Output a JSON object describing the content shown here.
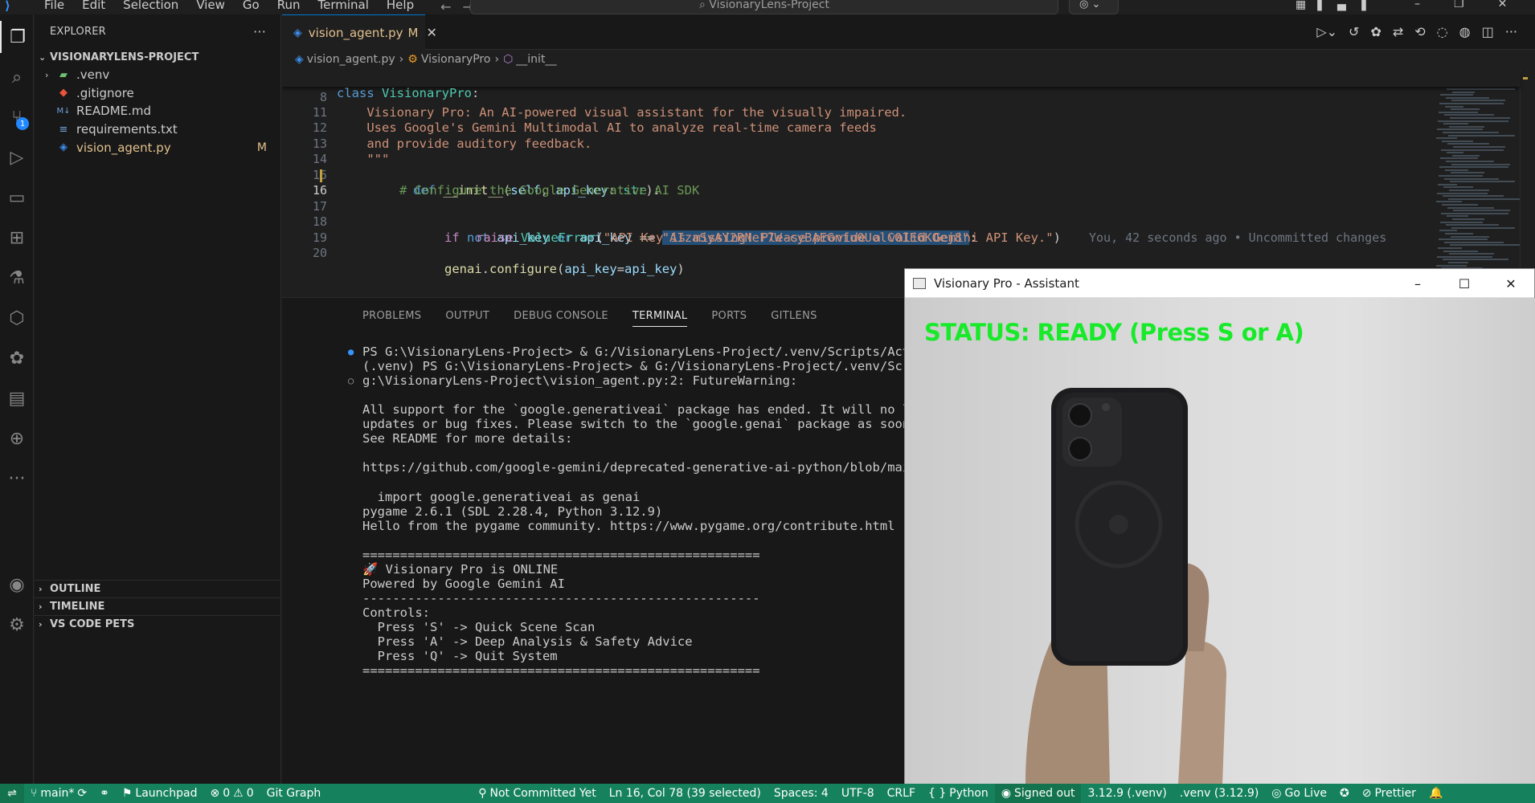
{
  "titlebar": {
    "menu": [
      "File",
      "Edit",
      "Selection",
      "View",
      "Go",
      "Run",
      "Terminal",
      "Help"
    ],
    "search_text": "VisionaryLens-Project"
  },
  "sidebar": {
    "title": "EXPLORER",
    "project": "VISIONARYLENS-PROJECT",
    "files": [
      {
        "name": ".venv",
        "icon": "folder-icon",
        "type": "folder"
      },
      {
        "name": ".gitignore",
        "icon": "git-icon",
        "type": "file"
      },
      {
        "name": "README.md",
        "icon": "markdown-icon",
        "type": "file"
      },
      {
        "name": "requirements.txt",
        "icon": "text-file-icon",
        "type": "file"
      },
      {
        "name": "vision_agent.py",
        "icon": "python-icon",
        "type": "file",
        "badge": "M"
      }
    ],
    "sections": [
      "OUTLINE",
      "TIMELINE",
      "VS CODE PETS"
    ]
  },
  "activity": {
    "scm_badge": "1"
  },
  "tab": {
    "name": "vision_agent.py",
    "badge": "M"
  },
  "breadcrumb": {
    "file": "vision_agent.py",
    "class": "VisionaryPro",
    "method": "__init__"
  },
  "editor": {
    "sticky_line": "class VisionaryPro:",
    "lines": [
      {
        "n": "8",
        "text": "    Visionary Pro: An AI-powered visual assistant for the visually impaired."
      },
      {
        "n": "11",
        "text": "    Uses Google's Gemini Multimodal AI to analyze real-time camera feeds"
      },
      {
        "n": "12",
        "text": "    and provide auditory feedback."
      },
      {
        "n": "13",
        "text": "    \"\"\""
      },
      {
        "n": "14",
        "text": "def __init__(self, api_key: str):"
      },
      {
        "n": "15",
        "text": "# Configure the Google Generative AI SDK"
      },
      {
        "n": "16",
        "text": "if not api_key or api_key == \"AIzaSyAY2RNeF7W-cyBAEGnfu0UolC0IE6KOej8\":"
      },
      {
        "n": "17",
        "text": "raise ValueError(\"API Key is missing! Please provide a valid Gemini API Key.\")"
      },
      {
        "n": "18",
        "text": ""
      },
      {
        "n": "19",
        "text": "genai.configure(api_key=api_key)"
      },
      {
        "n": "20",
        "text": ""
      }
    ],
    "blame": "You, 42 seconds ago • Uncommitted changes"
  },
  "panel": {
    "tabs": [
      "PROBLEMS",
      "OUTPUT",
      "DEBUG CONSOLE",
      "TERMINAL",
      "PORTS",
      "GITLENS"
    ],
    "active_tab": "TERMINAL",
    "terminal": [
      "PS G:\\VisionaryLens-Project> & G:/VisionaryLens-Project/.venv/Scripts/Activ",
      "(.venv) PS G:\\VisionaryLens-Project> & G:/VisionaryLens-Project/.venv/Scrip",
      "g:\\VisionaryLens-Project\\vision_agent.py:2: FutureWarning:",
      "",
      "All support for the `google.generativeai` package has ended. It will no lon",
      "updates or bug fixes. Please switch to the `google.genai` package as soon a",
      "See README for more details:",
      "",
      "https://github.com/google-gemini/deprecated-generative-ai-python/blob/main/",
      "",
      "  import google.generativeai as genai",
      "pygame 2.6.1 (SDL 2.28.4, Python 3.12.9)",
      "Hello from the pygame community. https://www.pygame.org/contribute.html",
      "",
      "=====================================================",
      "🚀 Visionary Pro is ONLINE",
      "Powered by Google Gemini AI",
      "-----------------------------------------------------",
      "Controls:",
      "  Press 'S' -> Quick Scene Scan",
      "  Press 'A' -> Deep Analysis & Safety Advice",
      "  Press 'Q' -> Quit System",
      "====================================================="
    ]
  },
  "appwin": {
    "title": "Visionary Pro - Assistant",
    "status": "STATUS: READY (Press S or A)"
  },
  "statusbar": {
    "branch": "main*",
    "launchpad": "Launchpad",
    "errors": "0",
    "warnings": "0",
    "git_graph": "Git Graph",
    "commit_status": "Not Committed Yet",
    "cursor": "Ln 16, Col 78 (39 selected)",
    "spaces": "Spaces: 4",
    "encoding": "UTF-8",
    "eol": "CRLF",
    "language": "Python",
    "account": "Signed out",
    "python_version": "3.12.9 (.venv)",
    "venv": ".venv (3.12.9)",
    "golive": "Go Live",
    "prettier": "Prettier"
  },
  "colors": {
    "statusbar_bg": "#16825d",
    "accent": "#0078d4",
    "overlay_text": "#18ea2a"
  }
}
